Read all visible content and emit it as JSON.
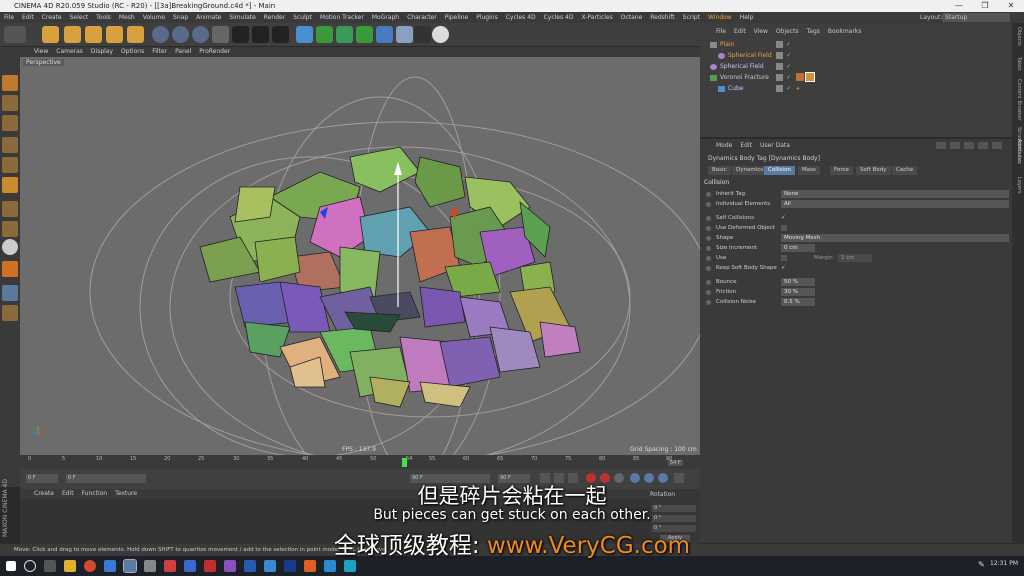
{
  "window": {
    "title": "CINEMA 4D R20.059 Studio (RC - R20) - [[3a]BreakingGround.c4d *] - Main",
    "controls": [
      "—",
      "❐",
      "✕"
    ]
  },
  "menubar": {
    "items": [
      "File",
      "Edit",
      "Create",
      "Select",
      "Tools",
      "Mesh",
      "Volume",
      "Snap",
      "Animate",
      "Simulate",
      "Render",
      "Sculpt",
      "Motion Tracker",
      "MoGraph",
      "Character",
      "Pipeline",
      "Plugins",
      "Cycles 4D",
      "Cycles 4D",
      "X-Particles",
      "Octane",
      "Redshift",
      "Script",
      "Window",
      "Help"
    ],
    "layout_label": "Layout:",
    "layout_value": "Startup"
  },
  "viewport": {
    "menu": [
      "View",
      "Cameras",
      "Display",
      "Options",
      "Filter",
      "Panel",
      "ProRender"
    ],
    "label": "Perspective",
    "fps": "FPS : 137.9",
    "grid_spacing": "Grid Spacing : 100 cm"
  },
  "timeline": {
    "ticks": [
      "0",
      "5",
      "10",
      "15",
      "20",
      "25",
      "30",
      "35",
      "40",
      "45",
      "50",
      "54",
      "55",
      "60",
      "65",
      "70",
      "75",
      "80",
      "85",
      "90"
    ],
    "current_frame": "54 F",
    "start_field": "0 F",
    "start_field2": "0 F",
    "end_field": "90 F",
    "end_field2": "90 F"
  },
  "material_manager": {
    "menu": [
      "Create",
      "Edit",
      "Function",
      "Texture"
    ]
  },
  "coordinates": {
    "header": "Rotation",
    "rows": [
      "0 °",
      "0 °",
      "0 °"
    ],
    "apply": "Apply"
  },
  "maxon_logo": "MAXON CINEMA 4D",
  "status_bar": "Move: Click and drag to move elements. Hold down SHIFT to quantize movement / add to the selection in point mode, CTRL to remove.",
  "object_manager": {
    "menu": [
      "File",
      "Edit",
      "View",
      "Objects",
      "Tags",
      "Bookmarks"
    ],
    "objects": [
      {
        "name": "Plain",
        "indent": 0,
        "color": "#f0a040"
      },
      {
        "name": "Spherical Field",
        "indent": 1,
        "color": "#f0a040"
      },
      {
        "name": "Spherical Field",
        "indent": 0,
        "color": "#c8c8ff"
      },
      {
        "name": "Voronoi Fracture",
        "indent": 0,
        "color": "#c8c8c8"
      },
      {
        "name": "Cube",
        "indent": 1,
        "color": "#c8c8ff"
      }
    ]
  },
  "attributes": {
    "menu": [
      "Mode",
      "Edit",
      "User Data"
    ],
    "title": "Dynamics Body Tag [Dynamics Body]",
    "tabs": [
      "Basic",
      "Dynamics",
      "Collision",
      "Mass",
      "Force",
      "Soft Body",
      "Cache"
    ],
    "active_tab": "Collision",
    "section": "Collision",
    "params": [
      {
        "label": "Inherit Tag",
        "value": "None"
      },
      {
        "label": "Individual Elements",
        "value": "All"
      },
      {
        "label": "Self Collisions",
        "value": "✓"
      },
      {
        "label": "Use Deformed Object",
        "value": ""
      },
      {
        "label": "Shape",
        "value": "Moving Mesh"
      },
      {
        "label": "Size Increment",
        "value": "0 cm"
      },
      {
        "label": "Use",
        "value": ""
      },
      {
        "label": "Keep Soft Body Shape",
        "value": "✓"
      },
      {
        "label": "Bounce",
        "value": "50 %"
      },
      {
        "label": "Friction",
        "value": "30 %"
      },
      {
        "label": "Collision Noise",
        "value": "0.5 %"
      }
    ],
    "margin_label": "Margin",
    "margin_value": "1 cm"
  },
  "right_strip": [
    "Objects",
    "Takes",
    "Content Browser",
    "Structure",
    "Attributes",
    "Layers"
  ],
  "taskbar": {
    "time": "12:31 PM"
  },
  "subtitles": {
    "chinese": "但是碎片会粘在一起",
    "english": "But pieces can get stuck on each other.",
    "ad_prefix": "全球顶级教程:",
    "ad_url": "www.VeryCG.com"
  },
  "colors": {
    "accent": "#f0a040",
    "active_tab": "#5a7aa0",
    "viewport_bg": "#6c6c6c"
  }
}
